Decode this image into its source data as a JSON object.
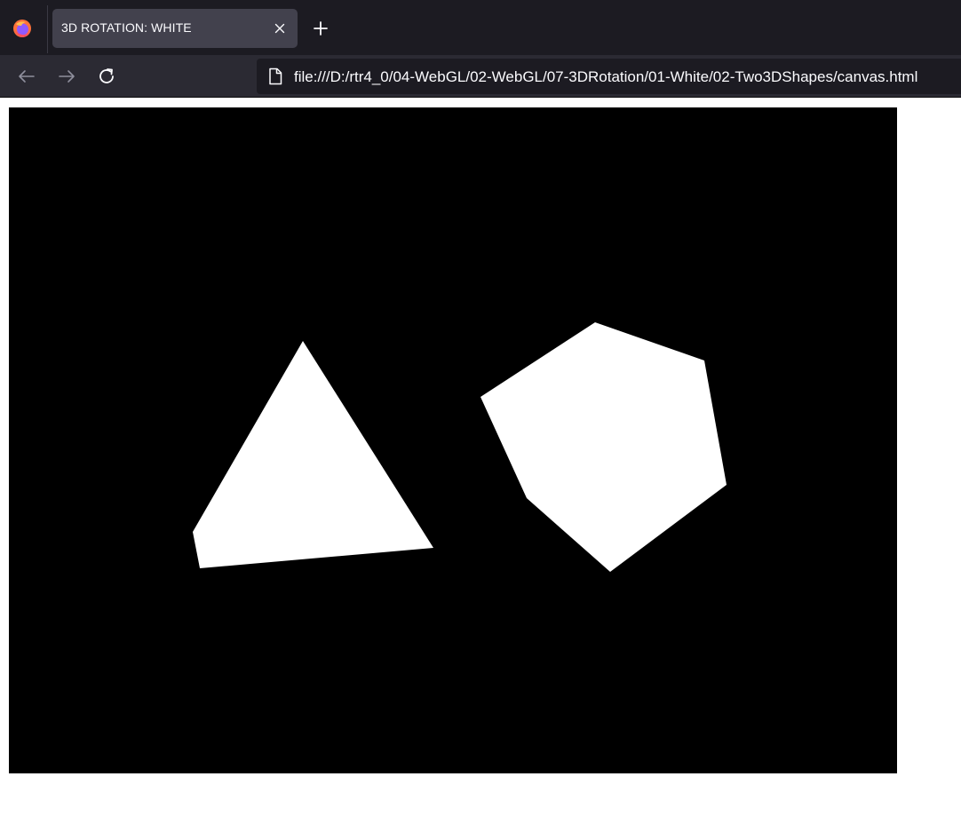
{
  "tab": {
    "title": "3D ROTATION: WHITE"
  },
  "icons": {
    "browser_logo": "firefox-icon",
    "close": "close-icon",
    "new_tab": "plus-icon",
    "back": "arrow-left-icon",
    "forward": "arrow-right-icon",
    "reload": "reload-icon",
    "page": "page-icon"
  },
  "urlbar": {
    "url": "file:///D:/rtr4_0/04-WebGL/02-WebGL/07-3DRotation/01-White/02-Two3DShapes/canvas.html"
  },
  "canvas": {
    "background": "#000000",
    "shape_color": "#ffffff",
    "shapes": [
      "triangle",
      "hexagon"
    ]
  },
  "colors": {
    "tabstrip": "#1c1b22",
    "toolbar": "#2b2a33",
    "tab_active": "#42414d"
  }
}
